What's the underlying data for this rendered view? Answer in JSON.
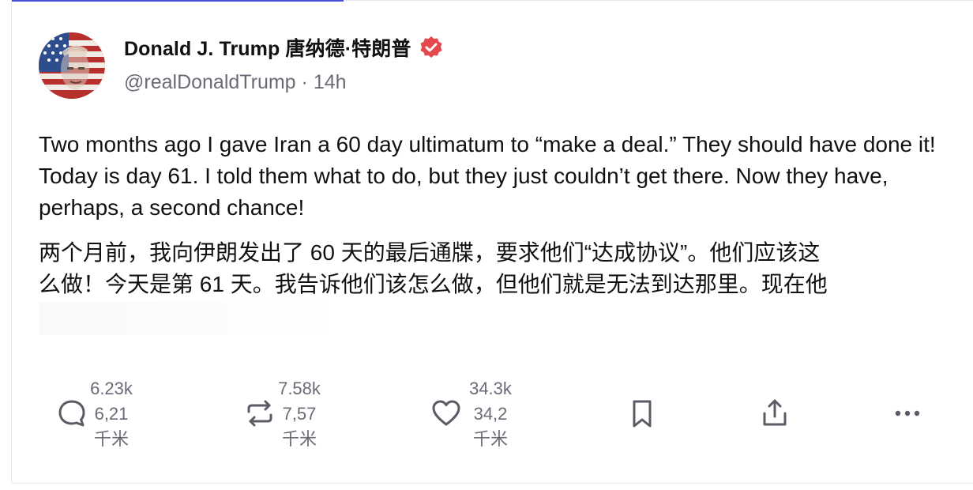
{
  "author": {
    "name": "Donald J. Trump",
    "name_cn": "唐纳德·特朗普",
    "handle": "@realDonaldTrump",
    "separator": "·",
    "time": "14h"
  },
  "post": {
    "text_en": "Two months ago I gave Iran a 60 day ultimatum to “make a deal.” They should have done it! Today is day 61. I told them what to do, but they just couldn’t get there. Now they have, perhaps, a second chance!",
    "text_zh_line1": "两个月前，我向伊朗发出了 60 天的最后通牒，要求他们“达成协议”。他们应该这",
    "text_zh_line2": "么做！今天是第 61 天。我告诉他们该怎么做，但他们就是无法到达那里。现在他"
  },
  "actions": {
    "reply": {
      "count": "6.23k",
      "count_cn_num": "6,21",
      "count_cn_unit": "千米"
    },
    "retruth": {
      "count": "7.58k",
      "count_cn_num": "7,57",
      "count_cn_unit": "千米"
    },
    "like": {
      "count": "34.3k",
      "count_cn_num": "34,2",
      "count_cn_unit": "千米"
    }
  },
  "icons": {
    "verified": "verified-badge-icon",
    "reply": "comment-bubble-icon",
    "retruth": "repost-arrows-icon",
    "like": "heart-icon",
    "bookmark": "bookmark-icon",
    "share": "share-upload-icon",
    "more": "more-dots-icon"
  },
  "colors": {
    "accent": "#4a4fd9",
    "verified": "#e5484d",
    "muted_text": "#6b6b78",
    "icon": "#5b5b66"
  }
}
